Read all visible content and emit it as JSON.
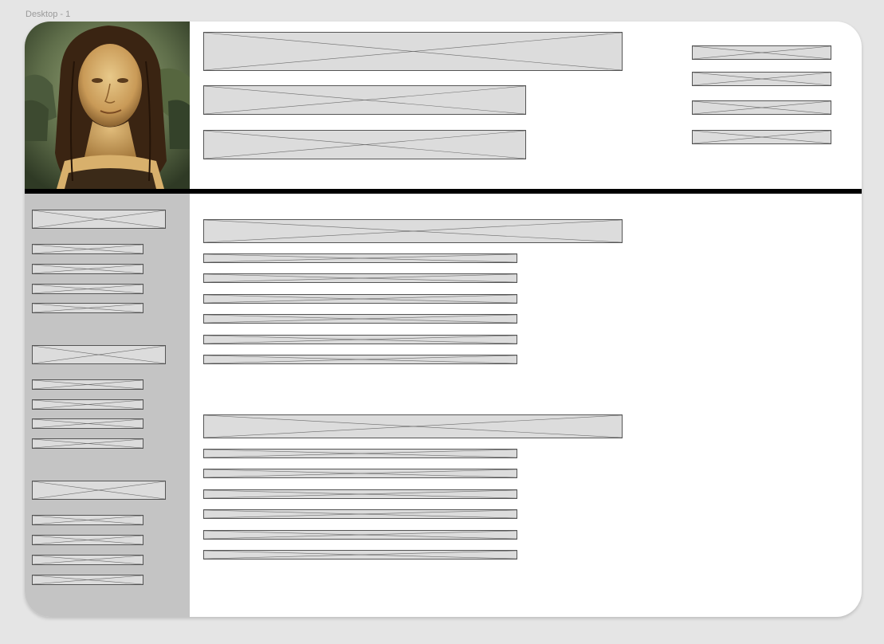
{
  "canvas": {
    "frame_label": "Desktop - 1",
    "background_color": "#e5e5e5",
    "frame_color": "#ffffff",
    "sidebar_color": "#c4c4c4",
    "divider_color": "#000000",
    "placeholder_fill": "#dcdcdc"
  },
  "header": {
    "portrait_image": "mona-lisa-portrait",
    "placeholders": [
      "title",
      "subtitle",
      "subtitle"
    ],
    "nav_links": [
      "nav-link",
      "nav-link",
      "nav-link",
      "nav-link"
    ]
  },
  "sidebar": {
    "groups": [
      {
        "heading": "heading",
        "items": [
          "item",
          "item",
          "item",
          "item"
        ]
      },
      {
        "heading": "heading",
        "items": [
          "item",
          "item",
          "item",
          "item"
        ]
      },
      {
        "heading": "heading",
        "items": [
          "item",
          "item",
          "item",
          "item"
        ]
      }
    ]
  },
  "main": {
    "sections": [
      {
        "heading": "heading",
        "lines": 6
      },
      {
        "heading": "heading",
        "lines": 6
      }
    ]
  }
}
